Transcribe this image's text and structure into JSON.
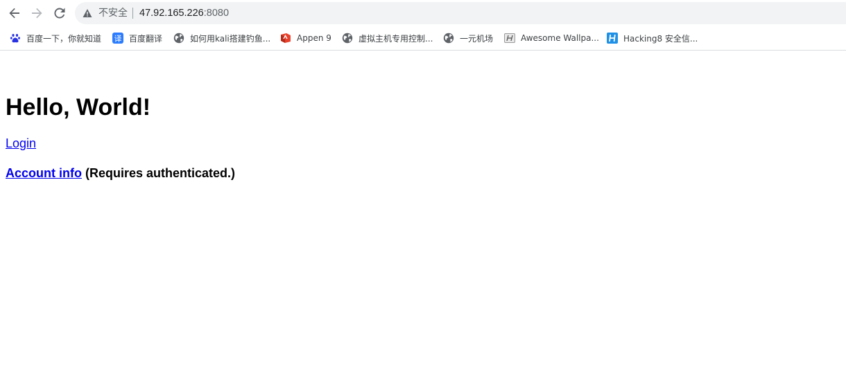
{
  "browser": {
    "security_label": "不安全",
    "url_host": "47.92.165.226",
    "url_port": ":8080"
  },
  "bookmarks": [
    {
      "label": "百度一下，你就知道",
      "icon": "baidu-paw-icon"
    },
    {
      "label": "百度翻译",
      "icon": "translate-icon"
    },
    {
      "label": "如何用kali搭建钓鱼...",
      "icon": "globe-icon"
    },
    {
      "label": "Appen 9",
      "icon": "appen-icon"
    },
    {
      "label": "虚拟主机专用控制...",
      "icon": "globe-icon"
    },
    {
      "label": "一元机场",
      "icon": "globe-icon"
    },
    {
      "label": "Awesome Wallpa...",
      "icon": "awesome-wallpapers-icon"
    },
    {
      "label": "Hacking8 安全信...",
      "icon": "hacking8-icon"
    }
  ],
  "colors": {
    "link": "#0000ee",
    "omnibox_bg": "#f1f3f4"
  },
  "page": {
    "heading": "Hello, World!",
    "login_link": "Login",
    "account_link": "Account info",
    "account_note": " (Requires authenticated.)"
  }
}
